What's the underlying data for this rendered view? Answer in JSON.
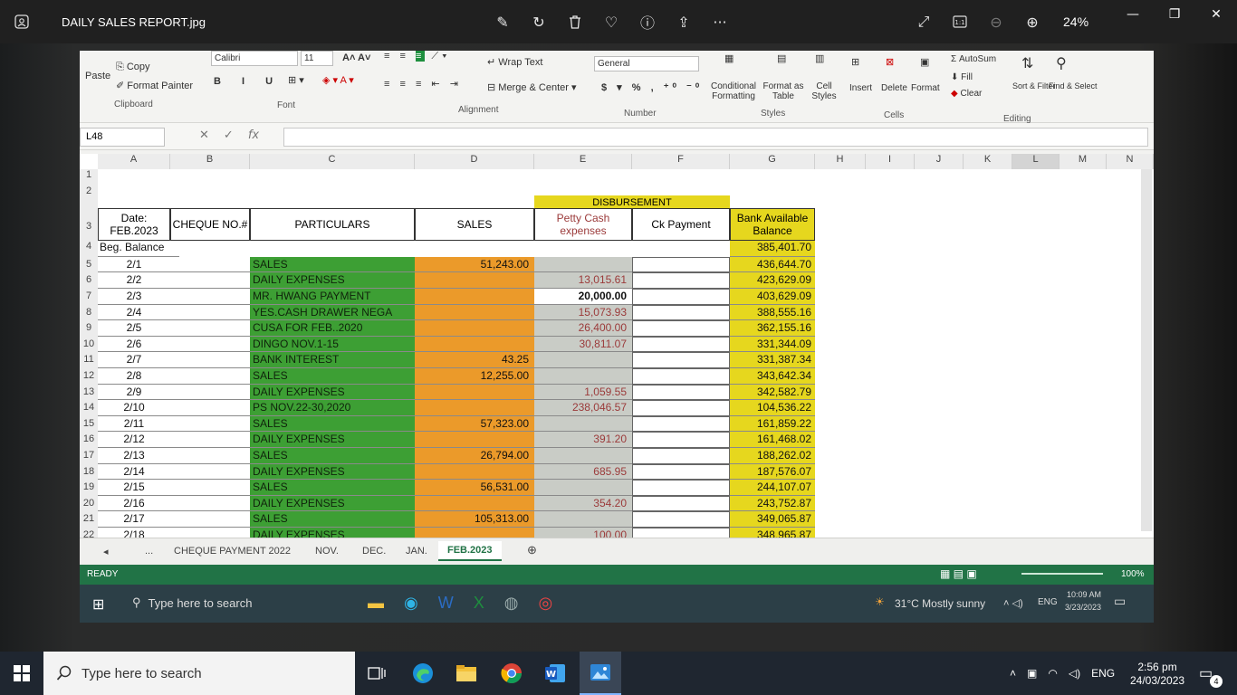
{
  "viewer": {
    "title": "DAILY SALES REPORT.jpg",
    "zoom": "24%"
  },
  "excel": {
    "ribbon": {
      "copy": "Copy",
      "format_painter": "Format Painter",
      "paste": "Paste",
      "clipboard": "Clipboard",
      "font_name": "Calibri",
      "font_size": "11",
      "font_group": "Font",
      "wrap_text": "Wrap Text",
      "merge_center": "Merge & Center",
      "alignment_group": "Alignment",
      "number_format": "General",
      "number_group": "Number",
      "conditional_formatting": "Conditional Formatting",
      "format_as_table": "Format as Table",
      "cell_styles": "Cell Styles",
      "styles_group": "Styles",
      "insert": "Insert",
      "delete": "Delete",
      "format": "Format",
      "cells_group": "Cells",
      "autosum": "AutoSum",
      "fill": "Fill",
      "clear": "Clear",
      "sort_filter": "Sort & Filter",
      "find_select": "Find & Select",
      "editing_group": "Editing"
    },
    "name_box": "L48",
    "columns": [
      "A",
      "B",
      "C",
      "D",
      "E",
      "F",
      "G",
      "H",
      "I",
      "J",
      "K",
      "L",
      "M",
      "N"
    ],
    "headers": {
      "date": "Date: FEB.2023",
      "cheque": "CHEQUE NO.#",
      "particulars": "PARTICULARS",
      "sales": "SALES",
      "disbursement": "DISBURSEMENT",
      "petty": "Petty Cash expenses",
      "ck": "Ck Payment",
      "bank": "Bank Available Balance",
      "beg": "Beg. Balance",
      "beg_value": "385,401.70"
    },
    "rows": [
      {
        "n": "5",
        "date": "2/1",
        "part": "SALES",
        "sales": "51,243.00",
        "petty": "",
        "bank": "436,644.70"
      },
      {
        "n": "6",
        "date": "2/2",
        "part": "DAILY EXPENSES",
        "sales": "",
        "petty": "13,015.61",
        "bank": "423,629.09"
      },
      {
        "n": "7",
        "date": "2/3",
        "part": "MR. HWANG PAYMENT",
        "sales": "",
        "petty": "20,000.00",
        "bank": "403,629.09"
      },
      {
        "n": "8",
        "date": "2/4",
        "part": "YES.CASH DRAWER NEGA",
        "sales": "",
        "petty": "15,073.93",
        "bank": "388,555.16"
      },
      {
        "n": "9",
        "date": "2/5",
        "part": "CUSA FOR FEB..2020",
        "sales": "",
        "petty": "26,400.00",
        "bank": "362,155.16"
      },
      {
        "n": "10",
        "date": "2/6",
        "part": "DINGO NOV.1-15",
        "sales": "",
        "petty": "30,811.07",
        "bank": "331,344.09"
      },
      {
        "n": "11",
        "date": "2/7",
        "part": "BANK INTEREST",
        "sales": "43.25",
        "petty": "",
        "bank": "331,387.34"
      },
      {
        "n": "12",
        "date": "2/8",
        "part": "SALES",
        "sales": "12,255.00",
        "petty": "",
        "bank": "343,642.34"
      },
      {
        "n": "13",
        "date": "2/9",
        "part": "DAILY EXPENSES",
        "sales": "",
        "petty": "1,059.55",
        "bank": "342,582.79"
      },
      {
        "n": "14",
        "date": "2/10",
        "part": "PS NOV.22-30,2020",
        "sales": "",
        "petty": "238,046.57",
        "bank": "104,536.22"
      },
      {
        "n": "15",
        "date": "2/11",
        "part": "SALES",
        "sales": "57,323.00",
        "petty": "",
        "bank": "161,859.22"
      },
      {
        "n": "16",
        "date": "2/12",
        "part": "DAILY EXPENSES",
        "sales": "",
        "petty": "391.20",
        "bank": "161,468.02"
      },
      {
        "n": "17",
        "date": "2/13",
        "part": "SALES",
        "sales": "26,794.00",
        "petty": "",
        "bank": "188,262.02"
      },
      {
        "n": "18",
        "date": "2/14",
        "part": "DAILY EXPENSES",
        "sales": "",
        "petty": "685.95",
        "bank": "187,576.07"
      },
      {
        "n": "19",
        "date": "2/15",
        "part": "SALES",
        "sales": "56,531.00",
        "petty": "",
        "bank": "244,107.07"
      },
      {
        "n": "20",
        "date": "2/16",
        "part": "DAILY EXPENSES",
        "sales": "",
        "petty": "354.20",
        "bank": "243,752.87"
      },
      {
        "n": "21",
        "date": "2/17",
        "part": "SALES",
        "sales": "105,313.00",
        "petty": "",
        "bank": "349,065.87"
      },
      {
        "n": "22",
        "date": "2/18",
        "part": "DAILY EXPENSES",
        "sales": "",
        "petty": "100.00",
        "bank": "348,965.87"
      }
    ],
    "sheet_tabs": [
      "CHEQUE PAYMENT 2022",
      "NOV.",
      "DEC.",
      "JAN.",
      "FEB.2023"
    ],
    "tab_ellipsis": "...",
    "status": "READY",
    "zoom_pct": "100%",
    "inner_taskbar": {
      "search": "Type here to search",
      "weather": "31°C  Mostly sunny",
      "lang": "ENG",
      "time": "10:09 AM",
      "date": "3/23/2023"
    }
  },
  "taskbar": {
    "search_placeholder": "Type here to search",
    "lang": "ENG",
    "time": "2:56 pm",
    "date": "24/03/2023",
    "notifications": "4"
  }
}
